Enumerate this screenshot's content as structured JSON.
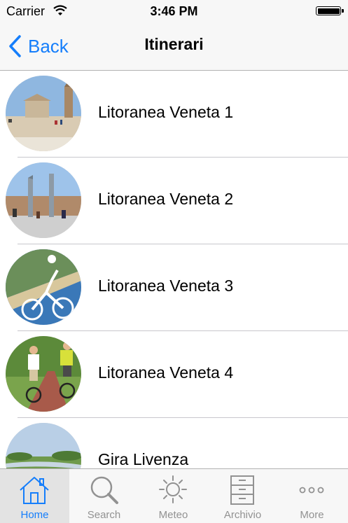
{
  "status_bar": {
    "carrier": "Carrier",
    "time": "3:46 PM"
  },
  "nav": {
    "back_label": "Back",
    "title": "Itinerari"
  },
  "colors": {
    "accent": "#157efb",
    "inactive": "#929292",
    "bar_bg": "#f7f7f7"
  },
  "list": {
    "items": [
      {
        "label": "Litoranea Veneta 1",
        "thumb": "church-beach-photo"
      },
      {
        "label": "Litoranea Veneta 2",
        "thumb": "square-monument-photo"
      },
      {
        "label": "Litoranea Veneta 3",
        "thumb": "cyclist-coast-photo"
      },
      {
        "label": "Litoranea Veneta 4",
        "thumb": "cyclists-path-photo"
      },
      {
        "label": "Gira Livenza",
        "thumb": "river-landscape-photo"
      }
    ]
  },
  "tabs": [
    {
      "label": "Home",
      "icon": "home-icon",
      "active": true
    },
    {
      "label": "Search",
      "icon": "search-icon",
      "active": false
    },
    {
      "label": "Meteo",
      "icon": "sun-icon",
      "active": false
    },
    {
      "label": "Archivio",
      "icon": "archive-icon",
      "active": false
    },
    {
      "label": "More",
      "icon": "more-icon",
      "active": false
    }
  ]
}
